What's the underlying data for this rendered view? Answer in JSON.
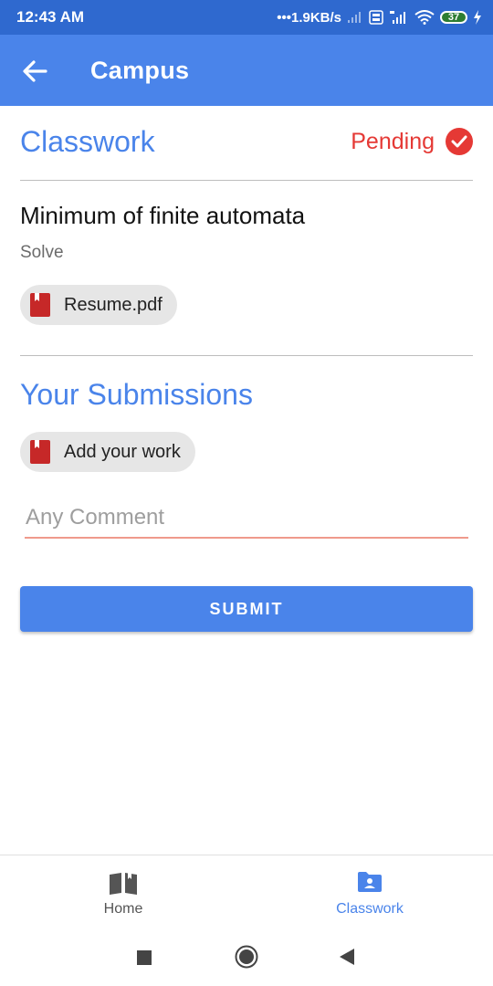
{
  "status_bar": {
    "time": "12:43 AM",
    "network_speed": "•••1.9KB/s",
    "battery": "37"
  },
  "app_bar": {
    "title": "Campus",
    "back_icon": "arrow-left-icon"
  },
  "classwork": {
    "section_title": "Classwork",
    "status_label": "Pending",
    "status_icon": "check-circle-icon",
    "task_title": "Minimum of finite automata",
    "task_subtitle": "Solve",
    "attachment_label": "Resume.pdf"
  },
  "submissions": {
    "section_title": "Your Submissions",
    "add_work_label": "Add your work",
    "comment_placeholder": "Any Comment",
    "submit_label": "SUBMIT"
  },
  "bottom_nav": {
    "items": [
      {
        "label": "Home",
        "icon": "open-book-icon",
        "active": false
      },
      {
        "label": "Classwork",
        "icon": "folder-person-icon",
        "active": true
      }
    ]
  },
  "colors": {
    "primary": "#4a84ea",
    "status_bar": "#2f69cf",
    "pending": "#e53935",
    "inactive_nav": "#555555"
  }
}
